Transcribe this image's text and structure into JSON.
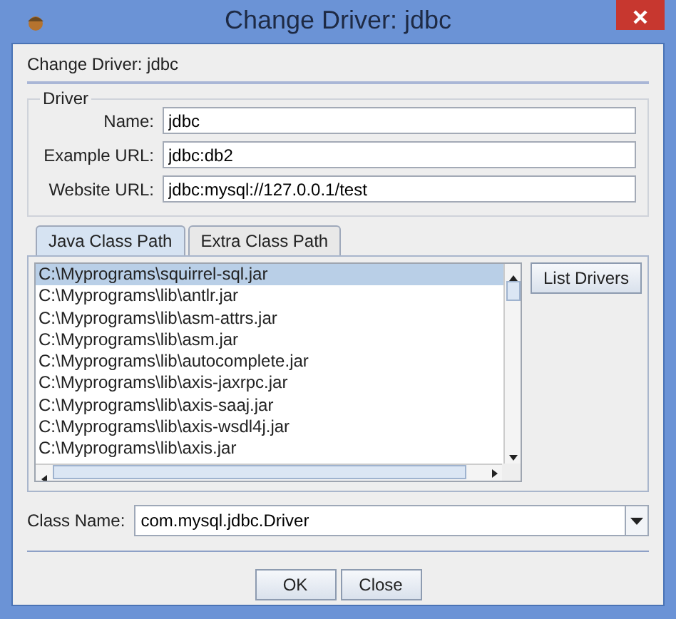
{
  "window": {
    "title": "Change Driver: jdbc"
  },
  "header": "Change Driver: jdbc",
  "driver": {
    "legend": "Driver",
    "fields": [
      {
        "label": "Name:",
        "value": "jdbc"
      },
      {
        "label": "Example URL:",
        "value": "jdbc:db2"
      },
      {
        "label": "Website URL:",
        "value": "jdbc:mysql://127.0.0.1/test"
      }
    ]
  },
  "tabs": [
    {
      "label": "Java Class Path",
      "selected": true
    },
    {
      "label": "Extra Class Path",
      "selected": false
    }
  ],
  "class_path": [
    {
      "path": "C:\\Myprograms\\squirrel-sql.jar",
      "selected": true
    },
    {
      "path": "C:\\Myprograms\\lib\\antlr.jar",
      "selected": false
    },
    {
      "path": "C:\\Myprograms\\lib\\asm-attrs.jar",
      "selected": false
    },
    {
      "path": "C:\\Myprograms\\lib\\asm.jar",
      "selected": false
    },
    {
      "path": "C:\\Myprograms\\lib\\autocomplete.jar",
      "selected": false
    },
    {
      "path": "C:\\Myprograms\\lib\\axis-jaxrpc.jar",
      "selected": false
    },
    {
      "path": "C:\\Myprograms\\lib\\axis-saaj.jar",
      "selected": false
    },
    {
      "path": "C:\\Myprograms\\lib\\axis-wsdl4j.jar",
      "selected": false
    },
    {
      "path": "C:\\Myprograms\\lib\\axis.jar",
      "selected": false
    }
  ],
  "list_drivers_button": "List Drivers",
  "class_name": {
    "label": "Class Name:",
    "value": "com.mysql.jdbc.Driver"
  },
  "buttons": [
    "OK",
    "Close"
  ]
}
